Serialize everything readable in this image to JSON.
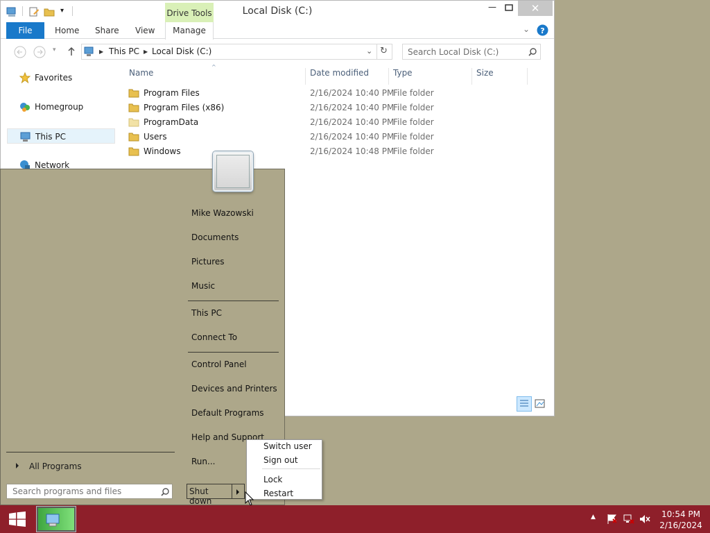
{
  "explorer": {
    "title": "Local Disk (C:)",
    "drive_tools_label": "Drive Tools",
    "ribbon_tabs": [
      "File",
      "Home",
      "Share",
      "View",
      "Manage"
    ],
    "breadcrumb": [
      "This PC",
      "Local Disk (C:)"
    ],
    "search_placeholder": "Search Local Disk (C:)",
    "nav": [
      "Favorites",
      "Homegroup",
      "This PC",
      "Network"
    ],
    "columns": [
      "Name",
      "Date modified",
      "Type",
      "Size"
    ],
    "files": [
      {
        "name": "Program Files",
        "date": "2/16/2024 10:40 PM",
        "type": "File folder"
      },
      {
        "name": "Program Files (x86)",
        "date": "2/16/2024 10:40 PM",
        "type": "File folder"
      },
      {
        "name": "ProgramData",
        "date": "2/16/2024 10:40 PM",
        "type": "File folder"
      },
      {
        "name": "Users",
        "date": "2/16/2024 10:40 PM",
        "type": "File folder"
      },
      {
        "name": "Windows",
        "date": "2/16/2024 10:48 PM",
        "type": "File folder"
      }
    ]
  },
  "start_menu": {
    "user": "Mike Wazowski",
    "items": [
      "Documents",
      "Pictures",
      "Music",
      "This PC",
      "Connect To",
      "Control Panel",
      "Devices and Printers",
      "Default Programs",
      "Help and Support",
      "Run..."
    ],
    "all_programs": "All Programs",
    "search_placeholder": "Search programs and files",
    "shutdown_label": "Shut down"
  },
  "shutdown_menu": {
    "items": [
      "Switch user",
      "Sign out",
      "Lock",
      "Restart"
    ]
  },
  "taskbar": {
    "time": "10:54 PM",
    "date": "2/16/2024",
    "color": "#8e1f2a"
  },
  "desktop_color": "#ada78a"
}
